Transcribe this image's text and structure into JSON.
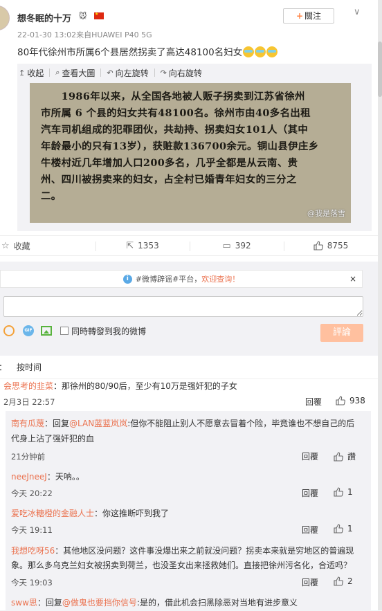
{
  "post": {
    "username": "想冬眠的十万",
    "badge": "🐭",
    "meta": "22-01-30 13:02来自HUAWEI P40 5G",
    "follow_label": "關注",
    "follow_plus": "+",
    "menu_icon": "∨",
    "text": "80年代徐州市所属6个县居然拐卖了高达48100名妇女",
    "emoji_count": 3
  },
  "media_tools": [
    {
      "icon": "↥",
      "label": "收起"
    },
    {
      "icon": "⌕",
      "label": "查看大圖"
    },
    {
      "icon": "↶",
      "label": "向左旋转"
    },
    {
      "icon": "↷",
      "label": "向右旋转"
    }
  ],
  "photo": {
    "lines": [
      "　　1986年以来，从全国各地被人贩子拐卖到江苏省徐州",
      "市所属 6 个县的妇女共有48100名。徐州市由40多名出租",
      "汽车司机组成的犯罪团伙，共劫持、拐卖妇女101人（其中",
      "年龄最小的只有13岁），获赃款136700余元。铜山县伊庄乡",
      "牛楼村近几年增加人口200多名，几乎全都是从云南、贵",
      "州、四川被拐卖来的妇女，占全村已婚青年妇女的三分之",
      "二。"
    ],
    "watermark": "@我是落雪"
  },
  "actions": {
    "favorite": {
      "icon": "☆",
      "label": "收藏"
    },
    "repost": {
      "icon": "⇱",
      "label": "1353"
    },
    "comment": {
      "icon": "▭",
      "label": "392"
    },
    "like": {
      "icon": "👍",
      "label": "8755"
    }
  },
  "notice": {
    "prefix": "#微博辟谣#平台，",
    "highlight": "欢迎查询！",
    "close": "×"
  },
  "composer": {
    "placeholder": "",
    "repost_checkbox_label": "同時轉發到我的微博",
    "submit_label": "評論",
    "gif_label": "GIF"
  },
  "sort": {
    "left_label": "：",
    "time_label": "按时间"
  },
  "comments": [
    {
      "user": "会思考的韭菜",
      "text": "：那徐州的80/90后，至少有10万是强奸犯的子女",
      "time": "2月3日 22:57",
      "reply": "回覆",
      "likes": "938",
      "subs": [
        {
          "user": "南有瓜蔑",
          "pre": "：回复",
          "mention": "@LAN蓝蓝岚岚",
          "text_line1": ":但你不能阻止别人不愿意去冒着个险，毕竟谁也不想自己的后",
          "text_line2": "代身上沾了强奸犯的血",
          "time": "21分钟前",
          "reply": "回覆",
          "likes": "讚"
        },
        {
          "user": "neeJneeJ",
          "text": "：天呐。。",
          "time": "今天 20:22",
          "reply": "回覆",
          "likes": "1"
        },
        {
          "user": "爱吃冰糖橙的金融人士",
          "text": "：你这推断吓到我了",
          "time": "今天 19:11",
          "reply": "回覆",
          "likes": "1"
        },
        {
          "user": "我想吃呀56",
          "text_line1": "：其他地区没问题？这件事没爆出来之前就没问题？拐卖本来就是穷地区的普遍现",
          "text_line2": "象。那么多乌克兰妇女被拐卖到荷兰，也没圣女出来拯救她们。直接把徐州污名化，合适吗？",
          "time": "今天 19:03",
          "reply": "回覆",
          "likes": "2"
        },
        {
          "user": "sww思",
          "pre": "：回复",
          "mention": "@做鬼也要挡你信号",
          "text": ":是的，借此机会扫黑除恶对当地有进步意义"
        }
      ]
    }
  ]
}
